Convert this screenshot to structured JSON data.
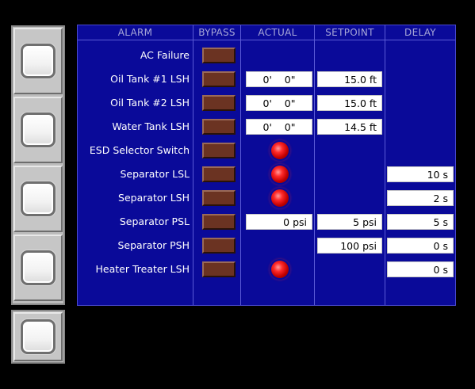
{
  "table": {
    "headers": {
      "alarm": "ALARM",
      "bypass": "BYPASS",
      "actual": "ACTUAL",
      "setpoint": "SETPOINT",
      "delay": "DELAY"
    },
    "rows": [
      {
        "label": "AC Failure"
      },
      {
        "label": "Oil Tank #1 LSH",
        "actual": "0'    0\"",
        "setpoint": "15.0 ft"
      },
      {
        "label": "Oil Tank #2 LSH",
        "actual": "0'    0\"",
        "setpoint": "15.0 ft"
      },
      {
        "label": "Water Tank LSH",
        "actual": "0'    0\"",
        "setpoint": "14.5 ft"
      },
      {
        "label": "ESD Selector Switch",
        "lamp": "red-indicator"
      },
      {
        "label": "Separator LSL",
        "lamp": "red-indicator",
        "delay": "10 s"
      },
      {
        "label": "Separator LSH",
        "lamp": "red-indicator",
        "delay": "2 s"
      },
      {
        "label": "Separator PSL",
        "actual": "0 psi",
        "setpoint": "5 psi",
        "delay": "5 s"
      },
      {
        "label": "Separator PSH",
        "setpoint": "100 psi",
        "delay": "0 s"
      },
      {
        "label": "Heater Treater LSH",
        "lamp": "red-indicator",
        "delay": "0 s"
      }
    ]
  },
  "colors": {
    "panel_background": "#0a0a99",
    "bypass_button": "#6b3322",
    "indicator_lamp": "#ff2a2a",
    "softkey_frame": "#bcbcbc"
  }
}
